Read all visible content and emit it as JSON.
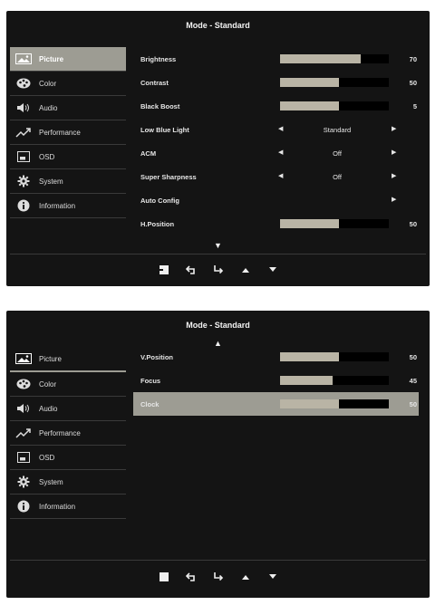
{
  "panel1": {
    "title": "Mode - Standard",
    "sidebar": [
      {
        "label": "Picture",
        "icon": "picture-icon",
        "active": true
      },
      {
        "label": "Color",
        "icon": "palette-icon"
      },
      {
        "label": "Audio",
        "icon": "speaker-icon"
      },
      {
        "label": "Performance",
        "icon": "trend-icon"
      },
      {
        "label": "OSD",
        "icon": "osd-icon"
      },
      {
        "label": "System",
        "icon": "gear-icon"
      },
      {
        "label": "Information",
        "icon": "info-icon"
      }
    ],
    "rows": [
      {
        "label": "Brightness",
        "type": "slider",
        "value": "70",
        "level": 0.74
      },
      {
        "label": "Contrast",
        "type": "slider",
        "value": "50",
        "level": 0.54
      },
      {
        "label": "Black Boost",
        "type": "slider",
        "value": "5",
        "level": 0.54
      },
      {
        "label": "Low Blue Light",
        "type": "option",
        "option": "Standard"
      },
      {
        "label": "ACM",
        "type": "option",
        "option": "Off"
      },
      {
        "label": "Super Sharpness",
        "type": "option",
        "option": "Off"
      },
      {
        "label": "Auto Config",
        "type": "action"
      },
      {
        "label": "H.Position",
        "type": "slider",
        "value": "50",
        "level": 0.54
      }
    ],
    "nav_icons": [
      "input-icon",
      "back-icon",
      "enter-icon",
      "up-icon",
      "down-icon"
    ]
  },
  "panel2": {
    "title": "Mode - Standard",
    "sidebar": [
      {
        "label": "Picture",
        "icon": "picture-icon",
        "active": true
      },
      {
        "label": "Color",
        "icon": "palette-icon"
      },
      {
        "label": "Audio",
        "icon": "speaker-icon"
      },
      {
        "label": "Performance",
        "icon": "trend-icon"
      },
      {
        "label": "OSD",
        "icon": "osd-icon"
      },
      {
        "label": "System",
        "icon": "gear-icon"
      },
      {
        "label": "Information",
        "icon": "info-icon"
      }
    ],
    "rows": [
      {
        "label": "V.Position",
        "type": "slider",
        "value": "50",
        "level": 0.54
      },
      {
        "label": "Focus",
        "type": "slider",
        "value": "45",
        "level": 0.48
      },
      {
        "label": "Clock",
        "type": "slider",
        "value": "50",
        "level": 0.54,
        "selected": true
      }
    ],
    "nav_icons": [
      "square-icon",
      "back-icon",
      "enter-icon",
      "up-icon",
      "down-icon"
    ]
  },
  "colors": {
    "panel": "#141414",
    "highlight": "#9d9c93",
    "bar_fill": "#b9b4a5",
    "text": "#e6e6e6"
  }
}
